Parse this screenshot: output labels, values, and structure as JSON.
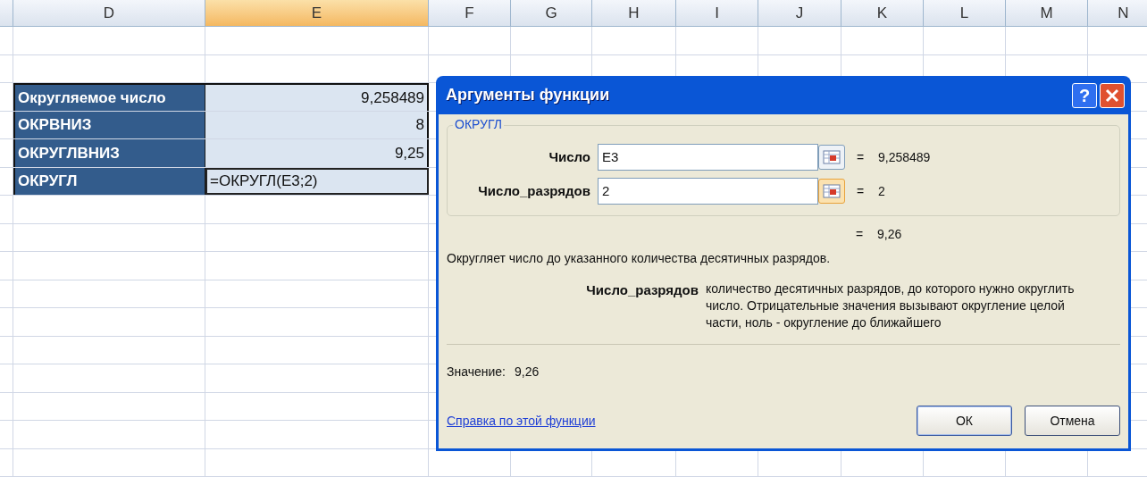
{
  "sheet": {
    "columns": [
      {
        "label": "D",
        "selected": false
      },
      {
        "label": "E",
        "selected": true
      },
      {
        "label": "F",
        "selected": false
      },
      {
        "label": "G",
        "selected": false
      },
      {
        "label": "H",
        "selected": false
      },
      {
        "label": "I",
        "selected": false
      },
      {
        "label": "J",
        "selected": false
      },
      {
        "label": "K",
        "selected": false
      },
      {
        "label": "L",
        "selected": false
      },
      {
        "label": "M",
        "selected": false
      },
      {
        "label": "N",
        "selected": false
      }
    ],
    "rows": [
      {
        "label": "Округляемое число",
        "value": "9,258489",
        "selected": false
      },
      {
        "label": "ОКРВНИЗ",
        "value": "8",
        "selected": false
      },
      {
        "label": "ОКРУГЛВНИЗ",
        "value": "9,25",
        "selected": false
      },
      {
        "label": "ОКРУГЛ",
        "value": "=ОКРУГЛ(E3;2)",
        "selected": true
      }
    ]
  },
  "dialog": {
    "title": "Аргументы функции",
    "help_button": "?",
    "function_name": "ОКРУГЛ",
    "arguments": [
      {
        "label": "Число",
        "value": "E3",
        "equals": "=",
        "result": "9,258489",
        "active": false
      },
      {
        "label": "Число_разрядов",
        "value": "2",
        "equals": "=",
        "result": "2",
        "active": true
      }
    ],
    "formula_equals": "=",
    "formula_result": "9,26",
    "description": "Округляет число до указанного количества десятичных разрядов.",
    "argument_name": "Число_разрядов",
    "argument_help": "количество десятичных разрядов, до которого нужно округлить число. Отрицательные значения вызывают округление целой части, ноль - округление до ближайшего",
    "value_label": "Значение:",
    "value": "9,26",
    "help_link": "Справка по этой функции",
    "buttons": [
      "ОК",
      "Отмена"
    ]
  }
}
